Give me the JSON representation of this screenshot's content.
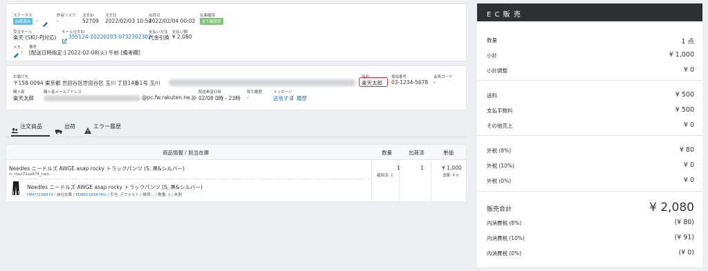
{
  "order": {
    "status_label": "ステータス",
    "status_badge": "出荷済み",
    "status_dash": "-",
    "permit_risk_label": "許容リスク",
    "permit_risk_value": "-",
    "order_id_label": "注文ID",
    "order_id": "52709",
    "order_date_label": "注文日",
    "order_date": "2022/02/03 10:54",
    "ship_date_label": "出荷日",
    "ship_date": "2022/02/04 00:02",
    "stock_label": "在庫確保",
    "stock_badge": "全て確保済",
    "mall_label": "受注モール",
    "mall_value": "楽天 (SKU-PJ対応)",
    "mall_order_label": "モール注文ID",
    "mall_order_id": "355124-20220203-0732302302",
    "pay_method_label": "支払い方法",
    "pay_method": "代金引換",
    "pay_amount_label": "支払い額",
    "pay_amount": "¥ 2,080",
    "memo_label": "メモ",
    "memo_value": "-",
    "remarks_label": "備考",
    "remarks_value": "[配送日時指定:] 2022-02-08(火) 午前 [備考欄]"
  },
  "customer": {
    "dest_label": "お届け先",
    "dest_value": "〒158-0094 東京都 世田谷区世田谷区 玉川     丁目14番1号 玉川",
    "name_label": "宛名",
    "name_value": "楽天太郎",
    "phone_label": "電話番号",
    "phone_value": "03-1234-5678",
    "member_label": "会員コード",
    "member_value": "-",
    "buyer_label": "購入者",
    "buyer_value": "楽天太郎",
    "email_label": "購入者メールアドレス",
    "email_value": "@pc.fw.rakuten.ne.jp",
    "delivery_time_label": "配送希望日時",
    "delivery_time_value": "02/08 0時 - 23時",
    "history_label": "取引履歴",
    "history_value": "-",
    "message_label": "メッセージ",
    "message_send": "送信する",
    "message_sep": "/",
    "message_history": "履歴"
  },
  "tabs": [
    {
      "label": "注文商品",
      "icon": "users-icon"
    },
    {
      "label": "出荷",
      "icon": "truck-icon"
    },
    {
      "label": "エラー履歴",
      "icon": "warning-icon"
    }
  ],
  "table": {
    "col_product": "商品情報 / 割当在庫",
    "col_qty": "数量",
    "col_shipped": "出荷済",
    "col_price": "単価",
    "row": {
      "name": "Needles ニードルズ AWGE asap rocky トラックパンツ (S, 黒&シルバー)",
      "sku": "rc_itayl72xa874_cam",
      "qty": "1",
      "qty_sub": "確保済: 1",
      "shipped": "1",
      "price": "¥ 1,000",
      "tax": "消費: ¥ 0",
      "sub_name": "Needles ニードルズ AWGE asap rocky トラックパンツ (S, 黒&シルバー)",
      "sub_code": "ITAYI72X8874",
      "sub_sep1": " / 自社在庫 / ",
      "sub_code2": "PD8661R5R7HU",
      "sub_rest": " / 引当: デフォルト / 推奨: - / 数量: 1 / 未割"
    }
  },
  "ec": {
    "title": "E C 販 売",
    "rows1": [
      {
        "k": "数量",
        "v": "1 点"
      },
      {
        "k": "小計",
        "v": "¥ 1,000"
      },
      {
        "k": "小計調整",
        "v": "¥ 0"
      }
    ],
    "rows2": [
      {
        "k": "送料",
        "v": "¥ 500"
      },
      {
        "k": "支払手数料",
        "v": "¥ 500"
      },
      {
        "k": "その他売上",
        "v": "¥ 0"
      }
    ],
    "rows3": [
      {
        "k": "外税 (8%)",
        "v": "¥ 80"
      },
      {
        "k": "外税 (10%)",
        "v": "¥ 0"
      },
      {
        "k": "外税 (0%)",
        "v": "¥ 0"
      }
    ],
    "total_label": "販売合計",
    "total_value": "¥ 2,080",
    "rows4": [
      {
        "k": "内消費税 (8%)",
        "v": "(¥ 80)"
      },
      {
        "k": "内消費税 (10%)",
        "v": "(¥ 91)"
      },
      {
        "k": "内消費税 (0%)",
        "v": "(¥ 0)"
      }
    ]
  },
  "colors": {
    "badge_blue": "#5bc0de",
    "badge_green": "#7cc576",
    "link": "#1a73c8",
    "highlight": "#e8292b",
    "ec_header": "#2f3235"
  }
}
